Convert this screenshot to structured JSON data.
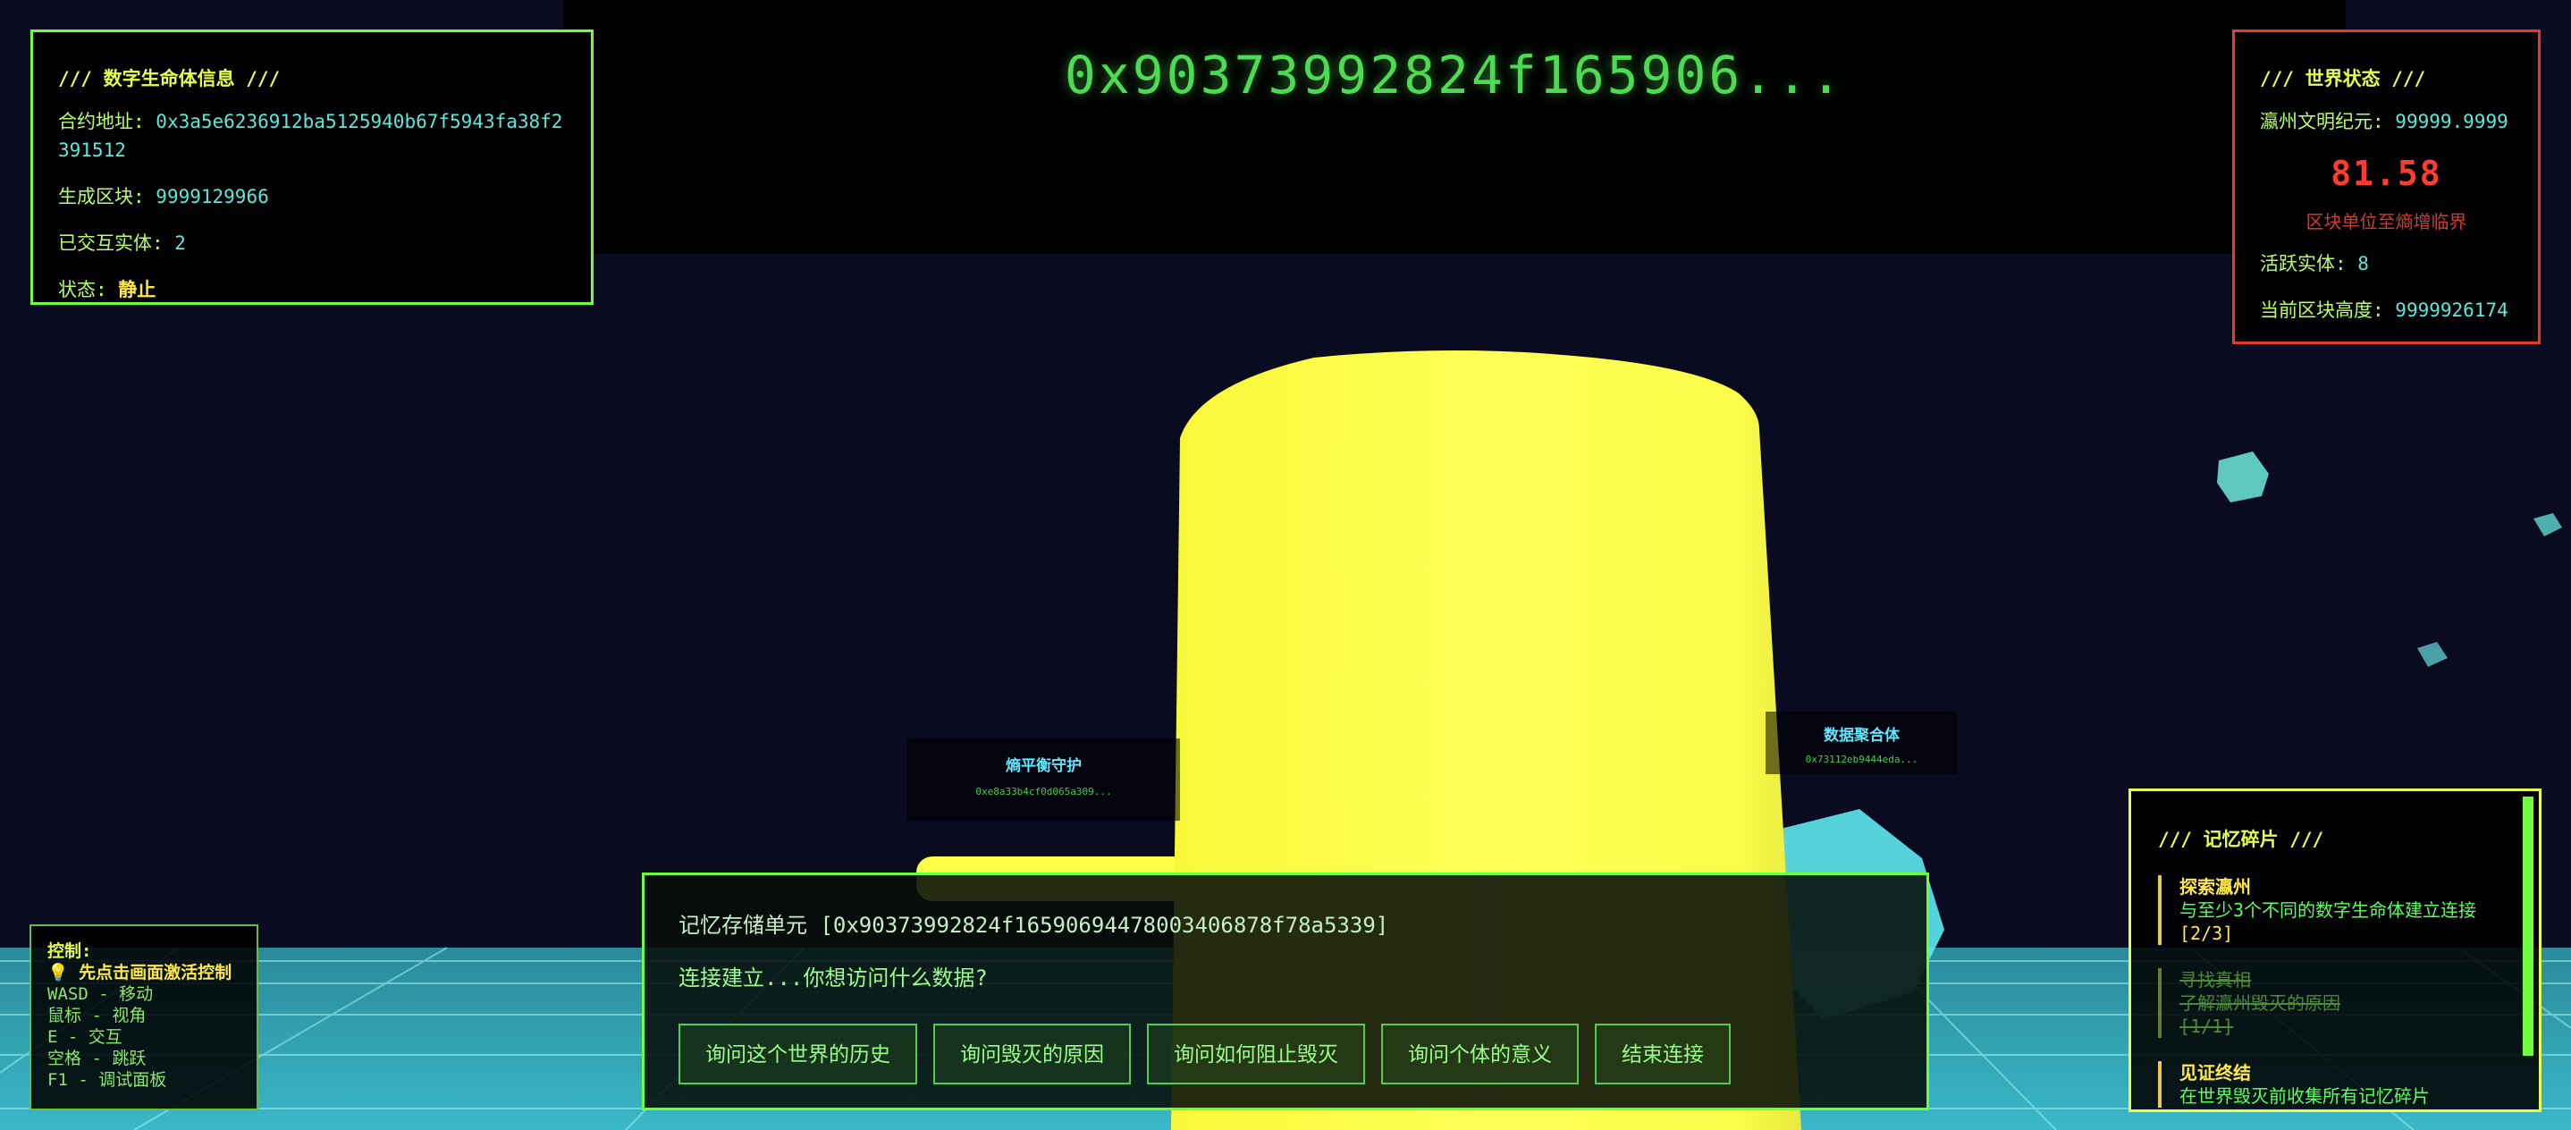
{
  "banner": {
    "hash": "0x90373992824f165906..."
  },
  "life_panel": {
    "header": "/// 数字生命体信息 ///",
    "contract_label": "合约地址: ",
    "contract_value": "0x3a5e6236912ba5125940b67f5943fa38f2391512",
    "block_label": "生成区块: ",
    "block_value": "9999129966",
    "interacted_label": "已交互实体: ",
    "interacted_value": "2",
    "status_label": "状态: ",
    "status_value": "静止"
  },
  "world_panel": {
    "header": "/// 世界状态 ///",
    "era_label": "瀛州文明纪元: ",
    "era_value": "99999.9999",
    "countdown": "81.58",
    "warning": "区块单位至熵增临界",
    "active_label": "活跃实体: ",
    "active_value": "8",
    "height_label": "当前区块高度: ",
    "height_value": "9999926174"
  },
  "controls": {
    "title": "控制:",
    "hint": "💡 先点击画面激活控制",
    "move": "WASD - 移动",
    "view": "鼠标 - 视角",
    "interact": "E - 交互",
    "jump": "空格 - 跳跃",
    "debug": "F1 - 调试面板"
  },
  "dialog": {
    "title": "记忆存储单元 [0x90373992824f16590694478003406878f78a5339]",
    "prompt": "连接建立...你想访问什么数据?",
    "buttons": [
      "询问这个世界的历史",
      "询问毁灭的原因",
      "询问如何阻止毁灭",
      "询问个体的意义",
      "结束连接"
    ]
  },
  "memory": {
    "header": "/// 记忆碎片 ///",
    "items": [
      {
        "title": "探索瀛州",
        "desc": "与至少3个不同的数字生命体建立连接",
        "progress": "[2/3]"
      },
      {
        "title": "寻找真相",
        "desc": "了解瀛州毁灭的原因",
        "progress": "[1/1]"
      },
      {
        "title": "见证终结",
        "desc": "在世界毁灭前收集所有记忆碎片"
      }
    ]
  },
  "entities": [
    {
      "name": "熵平衡守护",
      "hash": "0xe8a33b4cf0d065a309..."
    },
    {
      "name": "数据聚合体",
      "hash": "0x73112eb9444eda..."
    }
  ],
  "colors": {
    "accent": "#6dff3f",
    "warning": "#e83a2a",
    "pillar": "#ffff4a",
    "floor_grid": "#5de8e8"
  }
}
